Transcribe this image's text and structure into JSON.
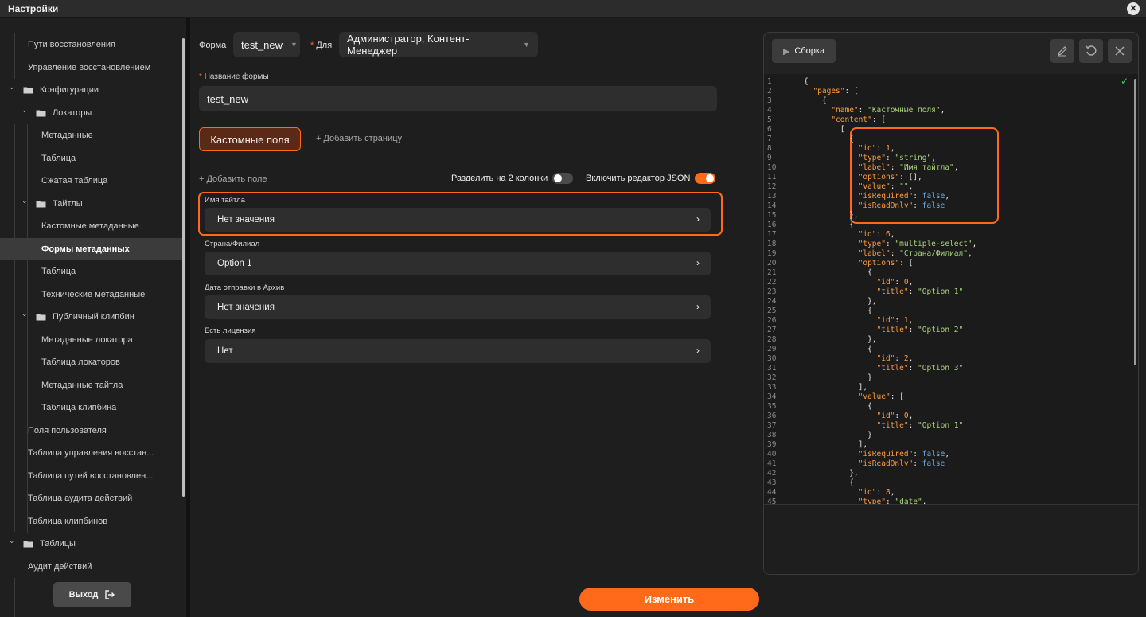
{
  "window": {
    "title": "Настройки",
    "close_glyph": "✕"
  },
  "sidebar": {
    "items": [
      {
        "label": "Пути восстановления",
        "level": 1,
        "folder": false
      },
      {
        "label": "Управление восстановлением",
        "level": 1,
        "folder": false
      },
      {
        "label": "Конфигурации",
        "level": 0,
        "folder": true
      },
      {
        "label": "Локаторы",
        "level": 1,
        "folder": true
      },
      {
        "label": "Метаданные",
        "level": 2,
        "folder": false
      },
      {
        "label": "Таблица",
        "level": 2,
        "folder": false
      },
      {
        "label": "Сжатая таблица",
        "level": 2,
        "folder": false
      },
      {
        "label": "Тайтлы",
        "level": 1,
        "folder": true
      },
      {
        "label": "Кастомные метаданные",
        "level": 2,
        "folder": false
      },
      {
        "label": "Формы метаданных",
        "level": 2,
        "folder": false,
        "active": true
      },
      {
        "label": "Таблица",
        "level": 2,
        "folder": false
      },
      {
        "label": "Технические метаданные",
        "level": 2,
        "folder": false
      },
      {
        "label": "Публичный клипбин",
        "level": 1,
        "folder": true
      },
      {
        "label": "Метаданные локатора",
        "level": 2,
        "folder": false
      },
      {
        "label": "Таблица локаторов",
        "level": 2,
        "folder": false
      },
      {
        "label": "Метаданные тайтла",
        "level": 2,
        "folder": false
      },
      {
        "label": "Таблица клипбина",
        "level": 2,
        "folder": false
      },
      {
        "label": "Поля пользователя",
        "level": 1,
        "folder": false
      },
      {
        "label": "Таблица управления восстан...",
        "level": 1,
        "folder": false
      },
      {
        "label": "Таблица путей восстановлен...",
        "level": 1,
        "folder": false
      },
      {
        "label": "Таблица аудита действий",
        "level": 1,
        "folder": false
      },
      {
        "label": "Таблица клипбинов",
        "level": 1,
        "folder": false
      },
      {
        "label": "Таблицы",
        "level": 0,
        "folder": true
      },
      {
        "label": "Аудит действий",
        "level": 1,
        "folder": false
      }
    ],
    "logout_label": "Выход"
  },
  "form": {
    "form_label": "Форма",
    "form_value": "test_new",
    "for_label": "Для",
    "for_value": "Администратор, Контент-Менеджер",
    "name_label": "Название формы",
    "name_value": "test_new",
    "tab_active": "Кастомные поля",
    "add_page": "+ Добавить страницу",
    "add_field": "+ Добавить поле",
    "split_label": "Разделить на 2 колонки",
    "split_on": false,
    "json_label": "Включить редактор JSON",
    "json_on": true,
    "fields": [
      {
        "label": "Имя тайтла",
        "value": "Нет значения"
      },
      {
        "label": "Страна/Филиал",
        "value": "Option 1"
      },
      {
        "label": "Дата отправки в Архив",
        "value": "Нет значения"
      },
      {
        "label": "Есть лицензия",
        "value": "Нет"
      }
    ],
    "submit_label": "Изменить"
  },
  "json_editor": {
    "build_label": "Сборка",
    "lines": [
      "{",
      "  \"pages\": [",
      "    {",
      "      \"name\": \"Кастомные поля\",",
      "      \"content\": [",
      "        [",
      "          {",
      "            \"id\": 1,",
      "            \"type\": \"string\",",
      "            \"label\": \"Имя тайтла\",",
      "            \"options\": [],",
      "            \"value\": \"\",",
      "            \"isRequired\": false,",
      "            \"isReadOnly\": false",
      "          },",
      "          {",
      "            \"id\": 6,",
      "            \"type\": \"multiple-select\",",
      "            \"label\": \"Страна/Филиал\",",
      "            \"options\": [",
      "              {",
      "                \"id\": 0,",
      "                \"title\": \"Option 1\"",
      "              },",
      "              {",
      "                \"id\": 1,",
      "                \"title\": \"Option 2\"",
      "              },",
      "              {",
      "                \"id\": 2,",
      "                \"title\": \"Option 3\"",
      "              }",
      "            ],",
      "            \"value\": [",
      "              {",
      "                \"id\": 0,",
      "                \"title\": \"Option 1\"",
      "              }",
      "            ],",
      "            \"isRequired\": false,",
      "            \"isReadOnly\": false",
      "          },",
      "          {",
      "            \"id\": 8,",
      "            \"type\": \"date\","
    ]
  },
  "colors": {
    "accent": "#ff6a1a",
    "valid": "#3ecf5e"
  }
}
